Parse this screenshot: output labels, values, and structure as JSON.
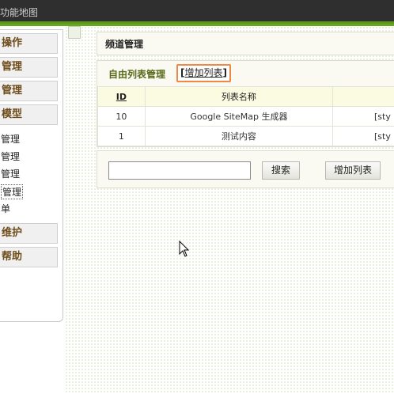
{
  "topbar": {
    "map_link": "功能地图"
  },
  "menu": {
    "heads": [
      "操作",
      "管理",
      "管理",
      "模型",
      "维护",
      "帮助"
    ],
    "items": [
      "管理",
      "管理",
      "管理",
      "管理",
      "单"
    ]
  },
  "page": {
    "title": "频道管理"
  },
  "list": {
    "title": "自由列表管理",
    "add_link": "增加列表",
    "bracket_open": "[",
    "bracket_close": "]",
    "columns": {
      "id": "ID",
      "name": "列表名称",
      "action": ""
    },
    "rows": [
      {
        "id": "10",
        "name": "Google SiteMap 生成器",
        "action": "[sty"
      },
      {
        "id": "1",
        "name": "测试内容",
        "action": "[sty"
      }
    ]
  },
  "search": {
    "input_value": "",
    "search_label": "搜索",
    "add_label": "增加列表"
  }
}
